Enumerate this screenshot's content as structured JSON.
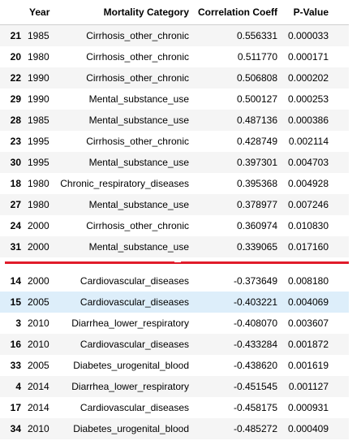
{
  "table_top": {
    "columns": {
      "year": "Year",
      "category": "Mortality Category",
      "coef": "Correlation Coeff",
      "pvalue": "P-Value"
    },
    "rows": [
      {
        "index": "21",
        "year": "1985",
        "category": "Cirrhosis_other_chronic",
        "coef": "0.556331",
        "pvalue": "0.000033"
      },
      {
        "index": "20",
        "year": "1980",
        "category": "Cirrhosis_other_chronic",
        "coef": "0.511770",
        "pvalue": "0.000171"
      },
      {
        "index": "22",
        "year": "1990",
        "category": "Cirrhosis_other_chronic",
        "coef": "0.506808",
        "pvalue": "0.000202"
      },
      {
        "index": "29",
        "year": "1990",
        "category": "Mental_substance_use",
        "coef": "0.500127",
        "pvalue": "0.000253"
      },
      {
        "index": "28",
        "year": "1985",
        "category": "Mental_substance_use",
        "coef": "0.487136",
        "pvalue": "0.000386"
      },
      {
        "index": "23",
        "year": "1995",
        "category": "Cirrhosis_other_chronic",
        "coef": "0.428749",
        "pvalue": "0.002114"
      },
      {
        "index": "30",
        "year": "1995",
        "category": "Mental_substance_use",
        "coef": "0.397301",
        "pvalue": "0.004703"
      },
      {
        "index": "18",
        "year": "1980",
        "category": "Chronic_respiratory_diseases",
        "coef": "0.395368",
        "pvalue": "0.004928"
      },
      {
        "index": "27",
        "year": "1980",
        "category": "Mental_substance_use",
        "coef": "0.378977",
        "pvalue": "0.007246"
      },
      {
        "index": "24",
        "year": "2000",
        "category": "Cirrhosis_other_chronic",
        "coef": "0.360974",
        "pvalue": "0.010830"
      },
      {
        "index": "31",
        "year": "2000",
        "category": "Mental_substance_use",
        "coef": "0.339065",
        "pvalue": "0.017160"
      }
    ]
  },
  "table_bottom": {
    "rows": [
      {
        "index": "14",
        "year": "2000",
        "category": "Cardiovascular_diseases",
        "coef": "-0.373649",
        "pvalue": "0.008180"
      },
      {
        "index": "15",
        "year": "2005",
        "category": "Cardiovascular_diseases",
        "coef": "-0.403221",
        "pvalue": "0.004069"
      },
      {
        "index": "3",
        "year": "2010",
        "category": "Diarrhea_lower_respiratory",
        "coef": "-0.408070",
        "pvalue": "0.003607"
      },
      {
        "index": "16",
        "year": "2010",
        "category": "Cardiovascular_diseases",
        "coef": "-0.433284",
        "pvalue": "0.001872"
      },
      {
        "index": "33",
        "year": "2005",
        "category": "Diabetes_urogenital_blood",
        "coef": "-0.438620",
        "pvalue": "0.001619"
      },
      {
        "index": "4",
        "year": "2014",
        "category": "Diarrhea_lower_respiratory",
        "coef": "-0.451545",
        "pvalue": "0.001127"
      },
      {
        "index": "17",
        "year": "2014",
        "category": "Cardiovascular_diseases",
        "coef": "-0.458175",
        "pvalue": "0.000931"
      },
      {
        "index": "34",
        "year": "2010",
        "category": "Diabetes_urogenital_blood",
        "coef": "-0.485272",
        "pvalue": "0.000409"
      }
    ]
  },
  "colors": {
    "divider": "#e01b2a",
    "hover_row": "#ddeefa",
    "striped_row": "#f5f5f5"
  }
}
